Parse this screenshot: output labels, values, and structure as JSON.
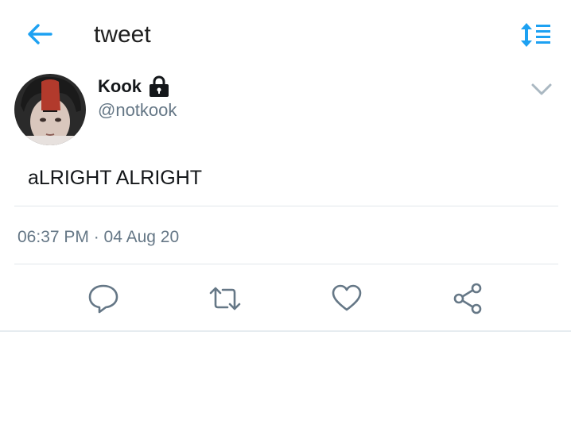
{
  "header": {
    "title": "tweet",
    "back_icon": "arrow-left-icon",
    "sort_icon": "sort-list-icon",
    "accent_color": "#1da1f2"
  },
  "author": {
    "name": "Kook",
    "handle": "@notkook",
    "protected_icon": "lock-icon",
    "menu_icon": "chevron-down-icon"
  },
  "tweet": {
    "text": "aLRIGHT ALRIGHT",
    "timestamp": "06:37 PM · 04 Aug 20"
  },
  "actions": [
    {
      "name": "reply",
      "icon": "speech-bubble-icon"
    },
    {
      "name": "retweet",
      "icon": "retweet-icon"
    },
    {
      "name": "like",
      "icon": "heart-icon"
    },
    {
      "name": "share",
      "icon": "share-icon"
    }
  ],
  "colors": {
    "text_primary": "#14171a",
    "text_secondary": "#657786",
    "divider": "#e1e6ea",
    "icon_gray": "#657786"
  }
}
